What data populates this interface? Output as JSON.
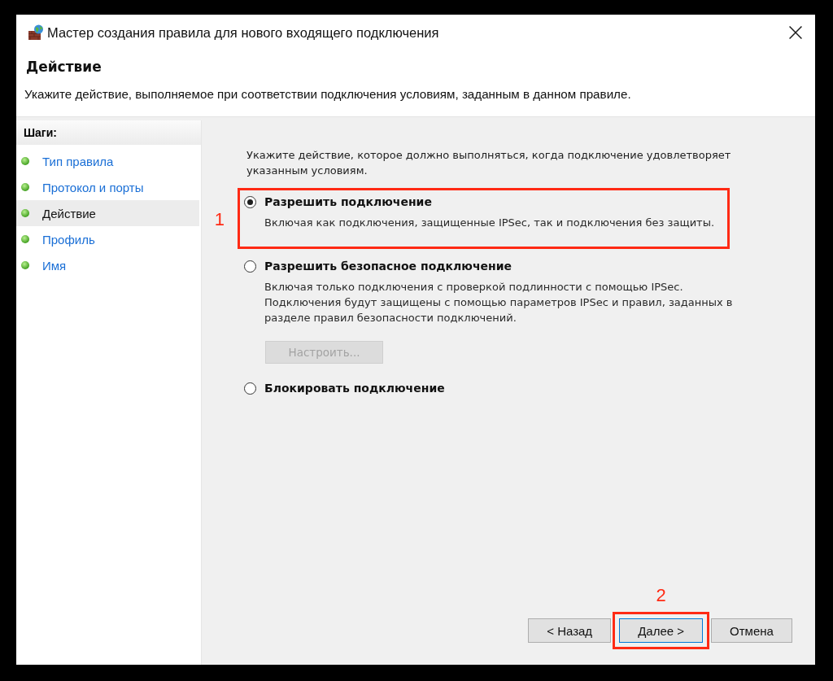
{
  "window": {
    "title": "Мастер создания правила для нового входящего подключения"
  },
  "header": {
    "title": "Действие",
    "description": "Укажите действие, выполняемое при соответствии подключения условиям, заданным в данном правиле."
  },
  "steps": {
    "title": "Шаги:",
    "items": [
      {
        "label": "Тип правила",
        "selected": false
      },
      {
        "label": "Протокол и порты",
        "selected": false
      },
      {
        "label": "Действие",
        "selected": true
      },
      {
        "label": "Профиль",
        "selected": false
      },
      {
        "label": "Имя",
        "selected": false
      }
    ]
  },
  "content": {
    "intro": "Укажите действие, которое должно выполняться, когда подключение удовлетворяет указанным условиям.",
    "options": [
      {
        "label": "Разрешить подключение",
        "description": "Включая как подключения, защищенные IPSec, так и подключения без защиты.",
        "selected": true,
        "annotation": "1"
      },
      {
        "label": "Разрешить безопасное подключение",
        "description": "Включая только подключения с проверкой подлинности с помощью IPSec. Подключения будут защищены с помощью параметров IPSec и правил, заданных в разделе правил безопасности подключений.",
        "selected": false,
        "button": {
          "label": "Настроить...",
          "disabled": true
        }
      },
      {
        "label": "Блокировать подключение",
        "selected": false
      }
    ]
  },
  "buttons": [
    {
      "label": "< Назад",
      "default": false
    },
    {
      "label": "Далее >",
      "default": true,
      "annotation": "2"
    },
    {
      "label": "Отмена",
      "default": false
    }
  ]
}
